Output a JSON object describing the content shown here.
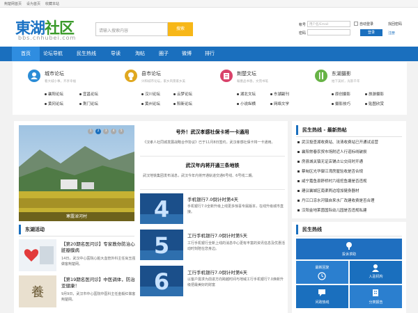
{
  "topbar": {
    "home": "荆楚网首页",
    "set_home": "设为首页",
    "bookmark": "收藏本站"
  },
  "logo": {
    "title_blue": "東湖",
    "title_green": "社区",
    "domain": "bbs.cnhubei.com"
  },
  "search": {
    "placeholder": "请输入搜索内容",
    "button": "搜索"
  },
  "login": {
    "account_label": "帐号",
    "account_placeholder": "用户名/Email",
    "password_label": "密码",
    "auto_login": "自动登录",
    "find_password": "找回密码",
    "login_button": "登录",
    "register": "注册"
  },
  "nav": [
    "首页",
    "论坛导航",
    "民生热线",
    "导读",
    "淘帖",
    "圈子",
    "微博",
    "排行"
  ],
  "categories": [
    {
      "title": "城市论坛",
      "sub": "看大城小事，齐享幸福",
      "links": [
        "襄阳论坛",
        "宜昌论坛",
        "黄冈论坛",
        "荆门论坛"
      ],
      "color": "#2b8cd6"
    },
    {
      "title": "县市论坛",
      "sub": "兴和城市论坛，家乡风景家乡美",
      "links": [
        "汉川论坛",
        "云梦论坛",
        "黄州论坛",
        "阳新论坛"
      ],
      "color": "#e0a820"
    },
    {
      "title": "荆楚文坛",
      "sub": "翰墨品书香，文苑书笔",
      "links": [
        "湖北文坛",
        "东湖副刊",
        "小说纵横",
        "网络文学"
      ],
      "color": "#d9436b"
    },
    {
      "title": "东湖摄影",
      "sub": "拍下美好，光影千年",
      "links": [
        "原创摄影",
        "旅游摄影",
        "摄影技巧",
        "贴图欣赏"
      ],
      "color": "#67b346"
    }
  ],
  "slider": {
    "caption": "寒露淖河村",
    "pages": [
      "1",
      "2",
      "3",
      "4",
      "5"
    ],
    "active": 1
  },
  "headlines": [
    {
      "title": "号外！武汉孝感社保卡将一卡通用",
      "body": "《汉孝人社同城发展战略合作协议》已于11月8日签约，武汉孝感社保卡将一卡通用。"
    },
    {
      "title": "武汉年内将开通三条地铁",
      "body": "武汉地铁集团发布消息，武汉今年内将开通轨道交通6号线、6号线二期。"
    }
  ],
  "downloads": [
    {
      "title": "手机银行7.0倒计时第4天",
      "body": "手机银行7.0全新升级上线更多惊喜专属版本，在线升级城市直接。",
      "digit": "4"
    },
    {
      "title": "工行手机银行7.0倒计时第5天",
      "body": "工行手机银行全新上线的消息中心更有丰富的资讯信息及优惠活动时刻陪在您身边。",
      "digit": "5"
    },
    {
      "title": "工行手机银行7.0倒计时第6天",
      "body": "以客户需求为前进方向跨越时间与地域工行手机银行7.0焕新升级把最美好的财富",
      "digit": "6"
    }
  ],
  "east": {
    "heading": "东湖活动",
    "items": [
      {
        "title": "【第20期名医问诊】专家教你防治心脏瓣膜病",
        "body": "14日，武汉中心医院心脏大血管外科主任尚玉强做客荆楚网。"
      },
      {
        "title": "【第19期名医问诊】中医调体，防治亚健康！",
        "body": "9月9日，武汉市中心医院中医科主任金毅红做客荆楚网。"
      }
    ]
  },
  "hotline": {
    "heading": "民生热线 - 最新热帖",
    "items": [
      "武汉投查湖收费站、法清收费站已开通试运营",
      "襄阳常春农贸市场附近人行道标线破损",
      "房县城关镇无证店铺占公交间时开通",
      "蔡甸区光华御江湾房屋验收是否合规",
      "咸宁嘉鱼县舒桥村六组挖鱼塘是否违规",
      "建议襄城区南渠两边增加健身器材",
      "丹江口凉水河镇自来水厂改建收费是否合理",
      "汉阳金地莱茵国际幼儿园是否违规私建"
    ]
  },
  "services": {
    "heading": "民生热线",
    "items": [
      "投诉求助",
      "最新回复",
      "入驻机构",
      "问政热线",
      "分类报告"
    ]
  },
  "colors": {
    "nav": "#1a6fbe",
    "nav_active": "#2f8de0",
    "search_btn": "#f7b718"
  }
}
